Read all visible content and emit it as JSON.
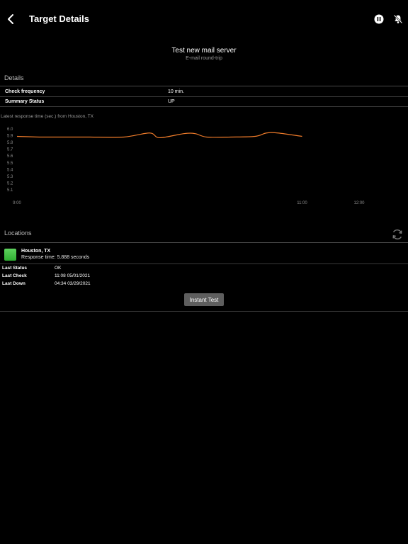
{
  "header": {
    "title": "Target Details",
    "icons": [
      "back-chevron-icon",
      "pause-icon",
      "bell-off-icon"
    ]
  },
  "target": {
    "name": "Test new mail server",
    "type": "E-mail round-trip"
  },
  "details": {
    "section_label": "Details",
    "rows": [
      {
        "label": "Check frequency",
        "value": "10 min."
      },
      {
        "label": "Summary Status",
        "value": "UP"
      }
    ]
  },
  "chart_caption": "Latest response time (sec.) from Houston, TX",
  "chart_data": {
    "type": "line",
    "title": "Latest response time (sec.) from Houston, TX",
    "y_ticks": [
      "6.0",
      "5.9",
      "5.8",
      "5.7",
      "5.6",
      "5.5",
      "5.4",
      "5.3",
      "5.2",
      "5.1"
    ],
    "x_ticks": [
      "9:00",
      "11:00",
      "12:00"
    ],
    "x_tick_hours": [
      9.0,
      11.0,
      11.4
    ],
    "xlim_hours": [
      9.0,
      11.4
    ],
    "ylim": [
      5.1,
      6.0
    ],
    "line_color": "#f07c2a",
    "series": [
      {
        "x": [
          9.0,
          9.17,
          9.33,
          9.5,
          9.75,
          9.93,
          10.0,
          10.17,
          10.25,
          10.33,
          10.5,
          10.67,
          10.75,
          10.83,
          11.0
        ],
        "y": [
          5.89,
          5.88,
          5.88,
          5.88,
          5.88,
          5.94,
          5.87,
          5.93,
          5.93,
          5.88,
          5.88,
          5.89,
          5.94,
          5.94,
          5.89
        ]
      }
    ]
  },
  "locations": {
    "section_label": "Locations",
    "refresh_icon": "refresh-icon",
    "items": [
      {
        "name": "Houston, TX",
        "response": "Response time: 5.888 seconds",
        "status_color": "#3cc43c"
      }
    ],
    "stats": [
      {
        "label": "Last Status",
        "value": "OK"
      },
      {
        "label": "Last Check",
        "value": "11:08 05/01/2021"
      },
      {
        "label": "Last Down",
        "value": "04:34 03/29/2021"
      }
    ],
    "instant_test_label": "Instant Test"
  }
}
